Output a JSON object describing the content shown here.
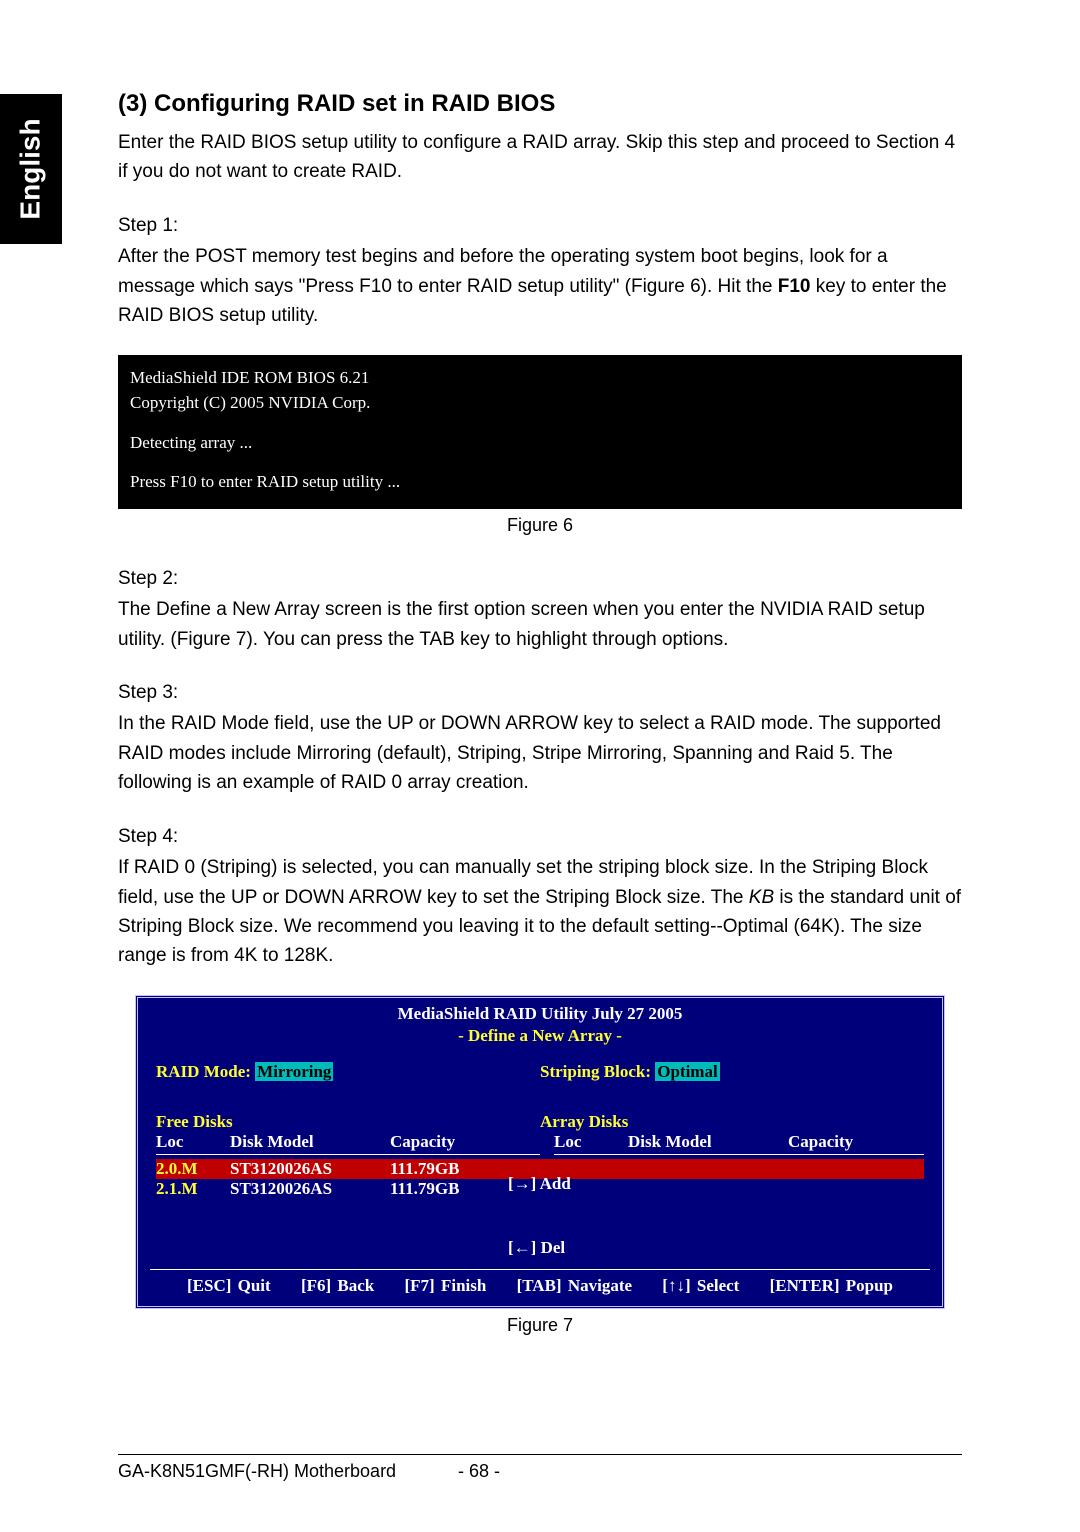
{
  "sideTab": "English",
  "title": "(3) Configuring RAID set in RAID BIOS",
  "intro": "Enter the RAID BIOS setup utility to configure a RAID array. Skip this step and proceed to Section 4 if you do not want to create RAID.",
  "step1": {
    "label": "Step 1:",
    "text_a": "After the POST memory test begins and before the operating system boot begins, look for a message which says \"Press F10 to enter RAID setup utility\" (Figure 6). Hit the ",
    "key": "F10",
    "text_b": " key to enter the RAID BIOS setup utility."
  },
  "biosBox": {
    "line1": "MediaShield IDE ROM BIOS 6.21",
    "line2": "Copyright (C) 2005 NVIDIA Corp.",
    "line3": "Detecting array ...",
    "line4": "Press F10 to enter RAID setup utility ..."
  },
  "fig6": "Figure 6",
  "step2": {
    "label": "Step 2:",
    "text": "The Define a New Array screen is the first option screen when you enter the NVIDIA RAID setup utility. (Figure 7). You can press the TAB key to highlight through options."
  },
  "step3": {
    "label": "Step 3:",
    "text": "In the RAID Mode field, use the UP or DOWN ARROW key to select a RAID mode. The supported RAID modes include Mirroring (default), Striping, Stripe Mirroring, Spanning and Raid 5. The following is an example of RAID 0 array creation."
  },
  "step4": {
    "label": "Step 4:",
    "text_a": "If RAID 0 (Striping) is selected, you can manually set the striping block size. In the Striping Block field, use the UP or DOWN ARROW key to set the Striping Block size. The ",
    "kb": "KB",
    "text_b": " is the standard unit of Striping Block size.  We recommend you leaving it to the default setting--Optimal (64K). The size range is from 4K to 128K."
  },
  "raidUtil": {
    "title": "MediaShield RAID Utility July 27 2005",
    "subtitle": "- Define a New Array -",
    "raidModeLabel": "RAID Mode:",
    "raidModeValue": "Mirroring",
    "stripingLabel": "Striping Block:",
    "stripingValue": "Optimal",
    "freeDisks": "Free Disks",
    "arrayDisks": "Array Disks",
    "colLoc": "Loc",
    "colModel": "Disk Model",
    "colCap": "Capacity",
    "disks": [
      {
        "loc": "2.0.M",
        "model": "ST3120026AS",
        "cap": "111.79GB",
        "selected": true
      },
      {
        "loc": "2.1.M",
        "model": "ST3120026AS",
        "cap": "111.79GB",
        "selected": false
      }
    ],
    "addLabel": "[→] Add",
    "delLabel": "[←] Del",
    "footer": {
      "quit": "[ESC] Quit",
      "back": "[F6] Back",
      "finish": "[F7] Finish",
      "nav": "[TAB] Navigate",
      "select": "[↑↓] Select",
      "popup": "[ENTER] Popup"
    }
  },
  "fig7": "Figure 7",
  "footer": {
    "board": "GA-K8N51GMF(-RH) Motherboard",
    "page": "- 68 -"
  }
}
